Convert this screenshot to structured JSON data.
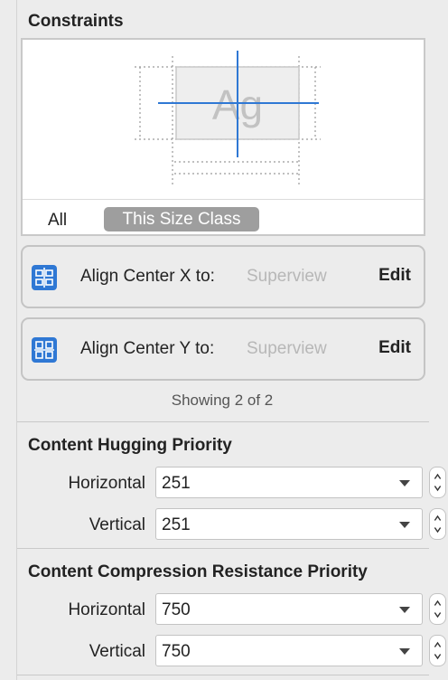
{
  "constraints": {
    "title": "Constraints",
    "preview_glyph": "Ag",
    "scope_all": "All",
    "scope_size_class": "This Size Class",
    "items": [
      {
        "label": "Align Center X to:",
        "target": "Superview",
        "action": "Edit",
        "icon": "align-center-x-icon"
      },
      {
        "label": "Align Center Y to:",
        "target": "Superview",
        "action": "Edit",
        "icon": "align-center-y-icon"
      }
    ],
    "showing": "Showing 2 of 2"
  },
  "hugging": {
    "title": "Content Hugging Priority",
    "horizontal_label": "Horizontal",
    "horizontal_value": "251",
    "vertical_label": "Vertical",
    "vertical_value": "251"
  },
  "compression": {
    "title": "Content Compression Resistance Priority",
    "horizontal_label": "Horizontal",
    "horizontal_value": "750",
    "vertical_label": "Vertical",
    "vertical_value": "750"
  },
  "colors": {
    "accent_blue": "#2f78d4",
    "segment_selected": "#9e9e9e",
    "placeholder_text": "#b7b7b7"
  }
}
